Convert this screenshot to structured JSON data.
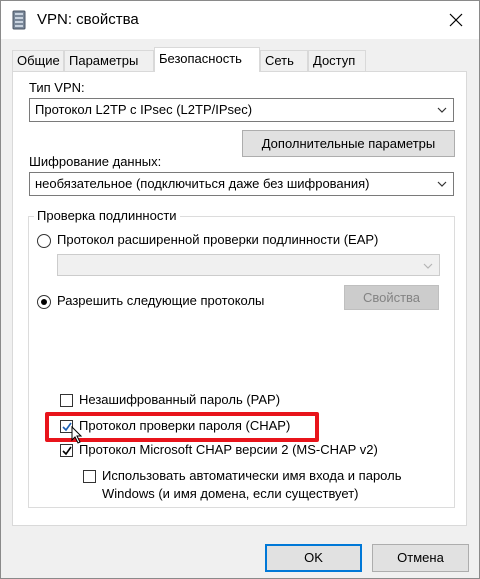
{
  "window": {
    "title": "VPN: свойства",
    "icon": "vpn-phone-icon"
  },
  "tabs": [
    {
      "label": "Общие",
      "active": false
    },
    {
      "label": "Параметры",
      "active": false
    },
    {
      "label": "Безопасность",
      "active": true
    },
    {
      "label": "Сеть",
      "active": false
    },
    {
      "label": "Доступ",
      "active": false
    }
  ],
  "security": {
    "vpn_type_label": "Тип VPN:",
    "vpn_type_value": "Протокол L2TP с IPsec (L2TP/IPsec)",
    "advanced_button": "Дополнительные параметры",
    "encryption_label": "Шифрование данных:",
    "encryption_value": "необязательное (подключиться даже без шифрования)",
    "auth_group_title": "Проверка подлинности",
    "eap_radio_label": "Протокол расширенной проверки подлинности (EAP)",
    "eap_radio_checked": false,
    "eap_combo_value": "",
    "allow_radio_label": "Разрешить следующие протоколы",
    "allow_radio_checked": true,
    "properties_button": "Свойства",
    "protocols": [
      {
        "label": "Незашифрованный пароль (PAP)",
        "checked": false
      },
      {
        "label": "Протокол проверки пароля (CHAP)",
        "checked": true
      },
      {
        "label": "Протокол Microsoft CHAP версии 2 (MS-CHAP v2)",
        "checked": true
      }
    ],
    "auto_logon_line1": "Использовать автоматически имя входа и пароль",
    "auto_logon_line2": "Windows (и имя домена, если существует)",
    "auto_logon_checked": false
  },
  "footer": {
    "ok_button": "OK",
    "cancel_button": "Отмена"
  },
  "colors": {
    "highlight": "#e8141b",
    "accent": "#0078d7"
  }
}
